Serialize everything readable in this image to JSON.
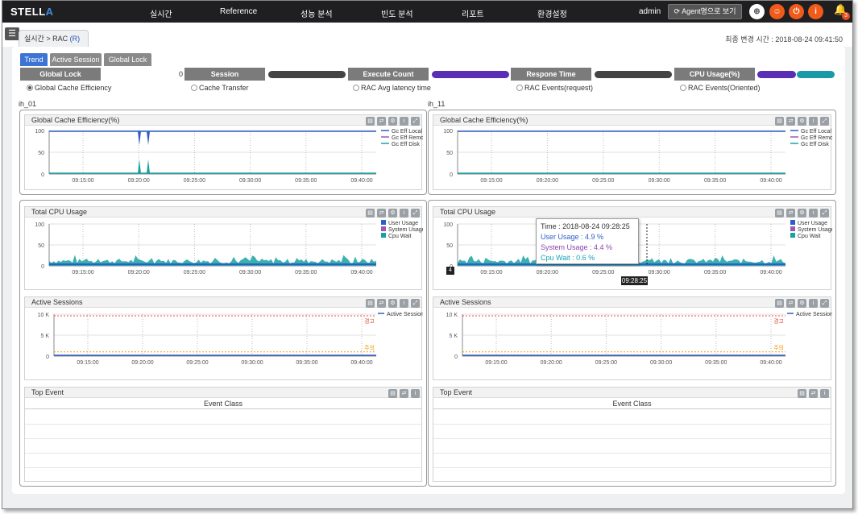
{
  "app": {
    "logo": "STELL",
    "logo_accent": "A"
  },
  "nav": [
    "실시간",
    "Reference",
    "성능 분석",
    "빈도 분석",
    "리포트",
    "환경설정"
  ],
  "user": "admin",
  "agent_button": "Agent명으로 보기",
  "notification_count": "3",
  "breadcrumb": {
    "path": "실시간 > RAC",
    "suffix": "(R)"
  },
  "last_change": "최종 변경 시간 : 2018-08-24 09:41:50",
  "tabs": [
    "Trend",
    "Active Session",
    "Global Lock"
  ],
  "metrics": {
    "global_lock": "Global Lock",
    "global_lock_value": "0",
    "session": "Session",
    "execute_count": "Execute Count",
    "respone_time": "Respone Time",
    "cpu_usage": "CPU Usage(%)"
  },
  "radios": [
    "Global Cache Efficiency",
    "Cache Transfer",
    "RAC Avg latency time",
    "RAC Events(request)",
    "RAC Events(Oriented)"
  ],
  "instances": [
    "ih_01",
    "ih_11"
  ],
  "panels": {
    "gce": "Global Cache Efficiency(%)",
    "cpu": "Total CPU Usage",
    "active": "Active Sessions",
    "top": "Top Event",
    "event_class": "Event Class"
  },
  "legends": {
    "gce": [
      "Gc Eff Local",
      "Gc Eff Remote",
      "Gc Eff Disk"
    ],
    "cpu": [
      "User Usage",
      "System Usage",
      "Cpu Wait"
    ],
    "active": [
      "Active Sessions"
    ]
  },
  "thresholds": {
    "warn": "경고",
    "caution": "주의"
  },
  "axis": {
    "x_ticks": [
      "09:15:00",
      "09:20:00",
      "09:25:00",
      "09:30:00",
      "09:35:00",
      "09:40:00"
    ],
    "y_pct": [
      "100",
      "50",
      "0"
    ],
    "y_sessions": [
      "10 K",
      "5 K",
      "0"
    ]
  },
  "tooltip": {
    "time": "Time : 2018-08-24 09:28:25",
    "user": "User Usage : 4.9 %",
    "system": "System Usage : 4.4 %",
    "cpuwait": "Cpu Wait : 0.6 %",
    "time_label": "09:28:25",
    "y_label": "4"
  },
  "colors": {
    "local": "#2f5cc8",
    "remote": "#9b59b6",
    "disk": "#17a2a2",
    "warn": "#e74c3c",
    "caution": "#f39c12",
    "bar_dark": "#444444",
    "bar_purple": "#5b2fb4",
    "bar_teal": "#1a9aa8"
  },
  "chart_data": [
    {
      "type": "line",
      "title": "Global Cache Efficiency(%)",
      "ylim": [
        0,
        100
      ],
      "series": [
        {
          "name": "Gc Eff Local",
          "values": [
            100,
            100,
            100,
            100,
            100,
            100,
            100,
            100,
            100,
            100,
            100,
            100,
            100,
            100,
            100,
            100,
            100,
            100,
            100,
            100,
            100,
            100,
            100,
            100,
            100,
            100,
            100,
            100,
            100,
            100,
            100,
            100,
            100,
            100,
            100,
            100,
            100,
            100,
            100,
            100,
            100,
            100,
            100,
            100,
            100,
            100,
            100,
            100,
            100,
            100,
            100,
            100,
            100,
            100,
            100,
            100,
            100,
            100,
            100,
            100,
            100,
            100,
            100,
            100,
            100,
            100,
            100,
            100,
            100,
            100,
            100,
            100,
            100,
            100,
            100,
            100,
            100,
            100,
            100,
            100,
            100,
            100,
            100,
            100,
            100,
            100,
            100,
            100,
            100,
            100,
            100,
            100,
            100,
            100,
            100,
            100,
            100,
            100,
            100,
            100,
            100,
            100,
            100,
            100,
            100,
            100,
            100,
            100,
            100,
            100,
            100,
            100,
            100,
            100,
            100,
            100,
            100,
            100,
            100,
            100,
            100,
            100,
            100,
            100,
            100,
            100,
            100,
            100,
            100,
            100,
            100,
            100,
            100,
            100,
            100,
            100,
            100,
            100,
            100,
            100,
            100,
            100,
            100,
            100,
            100,
            100,
            100,
            100,
            100,
            100,
            100,
            100,
            100,
            100,
            100,
            100,
            100,
            100,
            100,
            100,
            100,
            100,
            100,
            100,
            100,
            100,
            100,
            100,
            100,
            100,
            100,
            100,
            100,
            100,
            100,
            100,
            100,
            100,
            100,
            100,
            100,
            100,
            100,
            100,
            100,
            100,
            100,
            100,
            100,
            100,
            100,
            100,
            100,
            100,
            100,
            100,
            100,
            100,
            100,
            100,
            100,
            100,
            100,
            100,
            100,
            100,
            100,
            100,
            100,
            100,
            100,
            100,
            100,
            100,
            100,
            100,
            100,
            100,
            100,
            100,
            100,
            100,
            100,
            100,
            100,
            100,
            100,
            100,
            100,
            100,
            100,
            100,
            100,
            100,
            100,
            100,
            100,
            100,
            100,
            100,
            100,
            100,
            100,
            100,
            100,
            100,
            100,
            100,
            100,
            100,
            100,
            100,
            100,
            100,
            100,
            100,
            100,
            100,
            100,
            100,
            100,
            100,
            100,
            100,
            100,
            100,
            100,
            100,
            100,
            100,
            100,
            100,
            100,
            100,
            100,
            100,
            100,
            100,
            100,
            100,
            100,
            100,
            100,
            100,
            100,
            100,
            100,
            100,
            100,
            100,
            100,
            100,
            100,
            100,
            100,
            100,
            100,
            100,
            100,
            100,
            100,
            100,
            100,
            100,
            100,
            100,
            100,
            100,
            100,
            100,
            100,
            100,
            100,
            100,
            100,
            100,
            100,
            100,
            100,
            100,
            100,
            100,
            100,
            100,
            100,
            100,
            100,
            100,
            100,
            100,
            100,
            100,
            100,
            100,
            100,
            100,
            100,
            100,
            100,
            100,
            100,
            100,
            100,
            100,
            100,
            100,
            100,
            100,
            100,
            100,
            100,
            100,
            100,
            100,
            100,
            100,
            100,
            100,
            100,
            100,
            100,
            100,
            100,
            100,
            100,
            100,
            100,
            100,
            100,
            100,
            100,
            100,
            100,
            100,
            100,
            100,
            100,
            100,
            100,
            100,
            100,
            100,
            100,
            100,
            100,
            100,
            100,
            100,
            100,
            100,
            100,
            100,
            100,
            100,
            100,
            100,
            100,
            100,
            100,
            100,
            100,
            100,
            100,
            100,
            100,
            100,
            100
          ]
        }
      ]
    }
  ]
}
